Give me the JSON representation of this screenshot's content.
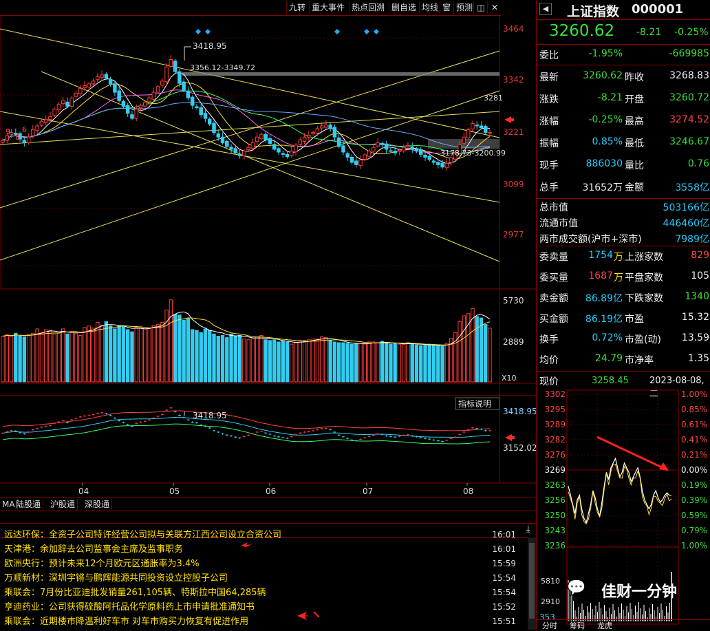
{
  "toolbar": {
    "items": [
      "九转",
      "重大事件",
      "热点回溯",
      "删自选",
      "均线",
      "窗",
      "预测"
    ],
    "restore_icon": "restore-icon",
    "close_icon": "close-icon"
  },
  "price_axis": {
    "labels": [
      "3464",
      "3342",
      "3221",
      "3099",
      "2977"
    ],
    "ylim": [
      2930,
      3510
    ]
  },
  "chart_annotations": {
    "high_label": "3418.95",
    "range_label": "3356.12-3349.72",
    "low_range_label": "3178.73-3200.99",
    "right_label": "3281",
    "left_numbers": [
      "9",
      "8",
      "6"
    ]
  },
  "volume_axis": {
    "labels": [
      "5730",
      "2889"
    ],
    "unit": "X10"
  },
  "indicator": {
    "button_label": "指标说明",
    "high_label": "3418.95",
    "axis_labels": [
      "3418.95",
      "3152.02"
    ]
  },
  "x_axis": {
    "months": [
      "04",
      "05",
      "06",
      "07",
      "08"
    ]
  },
  "bottom_tabs": [
    "MA",
    "陆股通",
    "沪股通",
    "深股通"
  ],
  "chart_data": {
    "type": "candlestick",
    "title": "",
    "x_ticks": [
      "04",
      "05",
      "06",
      "07",
      "08"
    ],
    "y_ticks": [
      3464,
      3342,
      3221,
      3099,
      2977
    ],
    "ylim": [
      2930,
      3510
    ],
    "closes": [
      3245,
      3255,
      3262,
      3258,
      3248,
      3240,
      3252,
      3268,
      3276,
      3286,
      3290,
      3296,
      3312,
      3322,
      3330,
      3318,
      3336,
      3346,
      3356,
      3362,
      3366,
      3372,
      3381,
      3385,
      3378,
      3366,
      3348,
      3330,
      3318,
      3303,
      3292,
      3312,
      3320,
      3326,
      3336,
      3348,
      3360,
      3372,
      3402,
      3418,
      3392,
      3367,
      3352,
      3336,
      3320,
      3315,
      3300,
      3292,
      3280,
      3262,
      3252,
      3240,
      3232,
      3226,
      3218,
      3212,
      3222,
      3230,
      3241,
      3252,
      3258,
      3246,
      3238,
      3226,
      3220,
      3215,
      3210,
      3222,
      3235,
      3246,
      3252,
      3256,
      3262,
      3270,
      3276,
      3278,
      3270,
      3252,
      3232,
      3220,
      3209,
      3198,
      3193,
      3203,
      3214,
      3222,
      3230,
      3240,
      3236,
      3226,
      3222,
      3218,
      3224,
      3230,
      3234,
      3226,
      3222,
      3215,
      3209,
      3204,
      3198,
      3193,
      3188,
      3196,
      3208,
      3218,
      3236,
      3252,
      3268,
      3281,
      3276,
      3272,
      3262,
      3262
    ],
    "volume_axis_ticks": [
      5730,
      2889
    ],
    "volume_unit": "X10",
    "volumes": [
      3150,
      3250,
      3150,
      3350,
      3150,
      3100,
      3250,
      3350,
      3650,
      3400,
      3600,
      3550,
      3300,
      3350,
      3650,
      3300,
      3450,
      3350,
      3200,
      3750,
      3850,
      3700,
      4100,
      3900,
      4150,
      3850,
      3650,
      3850,
      3850,
      3600,
      3450,
      3750,
      3800,
      3650,
      3700,
      3900,
      3950,
      4100,
      4950,
      5650,
      4650,
      4600,
      4250,
      4350,
      3600,
      3550,
      3400,
      3650,
      3550,
      3300,
      3150,
      3200,
      3050,
      3300,
      3150,
      3200,
      2950,
      2900,
      2950,
      3100,
      3200,
      2900,
      2850,
      2900,
      2750,
      2800,
      2750,
      2600,
      2700,
      2850,
      2850,
      2900,
      2950,
      2950,
      3100,
      3050,
      2850,
      2750,
      2700,
      2700,
      2650,
      2600,
      2650,
      2650,
      2600,
      2750,
      2750,
      2700,
      2800,
      2650,
      2600,
      2650,
      2600,
      2600,
      2700,
      2600,
      2550,
      2500,
      2550,
      2550,
      2500,
      2500,
      2450,
      2650,
      3000,
      3400,
      4150,
      4550,
      4700,
      5050,
      4500,
      4400,
      3950,
      3700
    ],
    "indicator_axis": [
      3418.95,
      3152.02
    ],
    "intraday_date": "2023-08-08,二",
    "intraday_price": 3258.45,
    "intraday_prev_close": 3268.83,
    "intraday_ylim": [
      3230,
      3302
    ],
    "intraday_prices": [
      3262,
      3258,
      3254,
      3250,
      3256,
      3258,
      3252,
      3248,
      3246,
      3250,
      3254,
      3260,
      3257,
      3252,
      3249,
      3255,
      3262,
      3268,
      3265,
      3270,
      3272,
      3274,
      3270,
      3266,
      3268,
      3272,
      3270,
      3268,
      3264,
      3266,
      3268,
      3270,
      3266,
      3260,
      3256,
      3254,
      3252,
      3254,
      3258,
      3260,
      3257,
      3255,
      3256,
      3258,
      3259,
      3258,
      3258
    ]
  },
  "stock": {
    "name": "上证指数",
    "code": "000001",
    "price": "3260.62",
    "change": "-8.21",
    "change_pct": "-0.25%"
  },
  "quote_rows": [
    {
      "l1": "委比",
      "v1": "-1.95%",
      "v1c": "green",
      "l2": "",
      "v2": "-669985",
      "v2c": "green"
    },
    {
      "l1": "最新",
      "v1": "3260.62",
      "v1c": "green",
      "l2": "昨收",
      "v2": "3268.83",
      "v2c": "white"
    },
    {
      "l1": "涨跌",
      "v1": "-8.21",
      "v1c": "green",
      "l2": "开盘",
      "v2": "3260.72",
      "v2c": "green"
    },
    {
      "l1": "涨幅",
      "v1": "-0.25%",
      "v1c": "green",
      "l2": "最高",
      "v2": "3274.52",
      "v2c": "red"
    },
    {
      "l1": "振幅",
      "v1": "0.85%",
      "v1c": "blue",
      "l2": "最低",
      "v2": "3246.67",
      "v2c": "green"
    },
    {
      "l1": "现手",
      "v1": "886030",
      "v1c": "blue",
      "l2": "量比",
      "v2": "0.76",
      "v2c": "green"
    },
    {
      "l1": "总手",
      "v1": "31652万",
      "v1c": "white",
      "l2": "金额",
      "v2": "3558亿",
      "v2c": "blue"
    }
  ],
  "market_rows": [
    {
      "label": "总市值",
      "value": "503166亿"
    },
    {
      "label": "流通市值",
      "value": "446460亿"
    },
    {
      "label": "两市成交额(沪市+深市)",
      "value": "7989亿"
    }
  ],
  "stat_rows": [
    {
      "l1": "委卖量",
      "v1": "1754",
      "u1": "万",
      "v1c": "blue",
      "l2": "上涨家数",
      "v2": "829",
      "v2c": "red"
    },
    {
      "l1": "委买量",
      "v1": "1687",
      "u1": "万",
      "v1c": "red",
      "l2": "平盘家数",
      "v2": "105",
      "v2c": "white"
    },
    {
      "l1": "卖金额",
      "v1": "86.89亿",
      "u1": "",
      "v1c": "blue",
      "l2": "下跌家数",
      "v2": "1340",
      "v2c": "green"
    },
    {
      "l1": "买金额",
      "v1": "86.19亿",
      "u1": "",
      "v1c": "blue",
      "l2": "市盈",
      "v2": "15.32",
      "v2c": "white"
    },
    {
      "l1": "换手",
      "v1": "0.72%",
      "v1c": "blue",
      "u1": "",
      "l2": "市盈(动)",
      "v2": "13.59",
      "v2c": "white"
    },
    {
      "l1": "均价",
      "v1": "24.79",
      "v1c": "green",
      "u1": "",
      "l2": "市净率",
      "v2": "1.35",
      "v2c": "white"
    }
  ],
  "intraday": {
    "label": "现价",
    "price": "3258.45",
    "date": "2023-08-08,二",
    "left_axis": [
      "3302",
      "3295",
      "3289",
      "3282",
      "3276",
      "3269",
      "3263",
      "3256",
      "3250",
      "3243",
      "3236"
    ],
    "right_axis": [
      "1.00%",
      "0.85%",
      "0.61%",
      "0.41%",
      "0.21%",
      "0.00%",
      "0.19%",
      "0.39%",
      "0.59%",
      "0.79%",
      "1.00%"
    ],
    "volume_labels": [
      "5810",
      "2910"
    ],
    "bottom_value": "353",
    "bottom_tabs": [
      "分时",
      "筹码",
      "龙虎"
    ]
  },
  "watermark": {
    "text": "佳财一分钟"
  },
  "news": [
    {
      "source": "远达环保：",
      "title": "全资子公司特许经营公司拟与关联方江西公司设立合资公司",
      "time": "16:01"
    },
    {
      "source": "天津港：",
      "title": "余加辞去公司监事会主席及监事职务",
      "time": "16:01"
    },
    {
      "source": "欧洲央行：",
      "title": "预计未来12个月欧元区通胀率为3.4%",
      "time": "15:59"
    },
    {
      "source": "万顺新材：",
      "title": "深圳宇锵与鹏辉能源共同投资设立控股子公司",
      "time": "15:54"
    },
    {
      "source": "乘联会：",
      "title": "7月份比亚迪批发销量261,105辆、特斯拉中国64,285辆",
      "time": "15:54"
    },
    {
      "source": "亨迪药业：",
      "title": "公司获得硫酸阿托品化学原料药上市申请批准通知书",
      "time": "15:52"
    },
    {
      "source": "乘联会：",
      "title": "近期楼市降温利好车市  对车市购买力恢复有促进作用",
      "time": "15:51"
    }
  ],
  "colors": {
    "up": "#ff3b3b",
    "down": "#33ccee",
    "frame": "#880000",
    "trend": "#e8e05a"
  }
}
